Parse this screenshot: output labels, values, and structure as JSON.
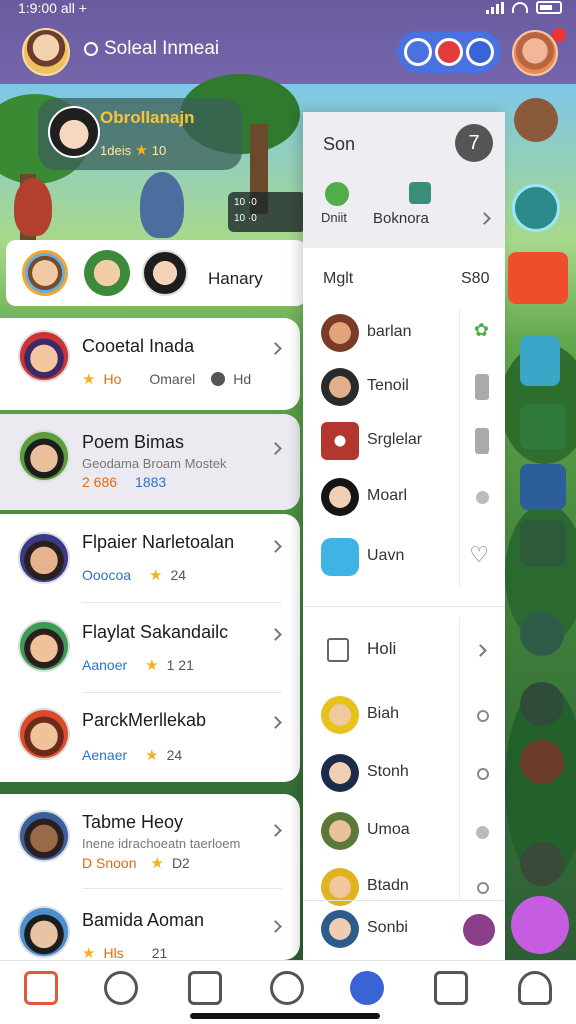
{
  "status_bar": {
    "time": "1:9:00 all +"
  },
  "header": {
    "title": "Soleal Inmeai"
  },
  "hero": {
    "title": "Obrollanajn",
    "subtitle": "1deis",
    "score": "10"
  },
  "hud": {
    "line1": "10 ·0",
    "line2": "10 ·0"
  },
  "stories": {
    "label": "Hanary"
  },
  "list": [
    {
      "name": "Cooetal Inada",
      "meta1": "Ho",
      "meta2": "Omarel",
      "meta3": "Hd"
    },
    {
      "name": "Poem Bimas",
      "sub": "Geodama Broam Mostek",
      "meta1": "2 686",
      "meta2": "1883"
    },
    {
      "name": "Flpaier Narletoalan",
      "meta1": "Ooocoa",
      "meta2": "24"
    },
    {
      "name": "Flaylat Sakandailc",
      "meta1": "Aanoer",
      "meta2": "1 21"
    },
    {
      "name": "ParckMerllekab",
      "meta1": "Aenaer",
      "meta2": "24"
    },
    {
      "name": "Tabme Heoy",
      "sub": "Inene idrachoeatn taerloem",
      "meta1": "D Snoon",
      "meta2": "D2"
    },
    {
      "name": "Bamida Aoman",
      "meta1": "Hls",
      "meta2": "21"
    }
  ],
  "panel": {
    "title": "Son",
    "close_label": "7",
    "row1_left": "Dniit",
    "row1_right": "Boknora",
    "section1": "Mglt",
    "section1_right": "S80",
    "items_a": [
      {
        "label": "barlan"
      },
      {
        "label": "Tenoil"
      },
      {
        "label": "Srglelar"
      },
      {
        "label": "Moarl"
      },
      {
        "label": "Uavn"
      }
    ],
    "section2": "Holi",
    "items_b": [
      {
        "label": "Biah"
      },
      {
        "label": "Stonh"
      },
      {
        "label": "Umoa"
      },
      {
        "label": "Btadn"
      }
    ],
    "bottom_user": "Sonbi"
  },
  "colors": {
    "header": "#6a5a9e",
    "accent_blue": "#4a71e0",
    "accent_red": "#e23b3b",
    "star": "#f2b21c",
    "fab": "#c65ce0"
  }
}
